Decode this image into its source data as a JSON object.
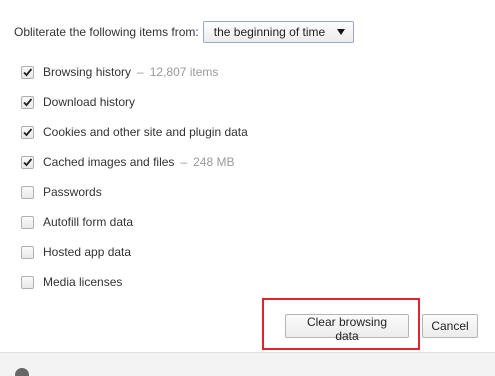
{
  "time_range": {
    "label": "Obliterate the following items from:",
    "selected": "the beginning of time"
  },
  "items": [
    {
      "label": "Browsing history",
      "checked": true,
      "count": "12,807 items"
    },
    {
      "label": "Download history",
      "checked": true
    },
    {
      "label": "Cookies and other site and plugin data",
      "checked": true
    },
    {
      "label": "Cached images and files",
      "checked": true,
      "count": "248 MB"
    },
    {
      "label": "Passwords",
      "checked": false
    },
    {
      "label": "Autofill form data",
      "checked": false
    },
    {
      "label": "Hosted app data",
      "checked": false
    },
    {
      "label": "Media licenses",
      "checked": false
    }
  ],
  "buttons": {
    "clear": "Clear browsing data",
    "cancel": "Cancel"
  },
  "icons": {
    "dropdown": "chevron-down-icon",
    "check": "checkmark-icon",
    "footer": "info-icon"
  },
  "colors": {
    "highlight": "#e3242b",
    "dropdown_border": "#9aa9c0"
  }
}
